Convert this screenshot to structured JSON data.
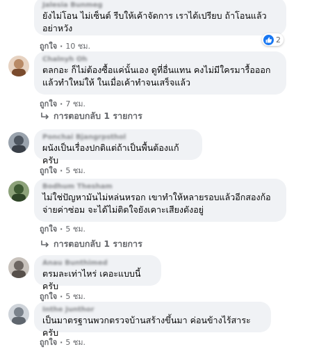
{
  "comments": [
    {
      "author": "Jalesia Bunmeg",
      "text": "ยังไม่โอน ไม่เซ็นต์ รีบให้เค้าจัดการ เราได้เปรียบ ถ้าโอนแล้ว\nอย่าหวัง",
      "like_label": "ถูกใจ",
      "time": "10 ชม.",
      "reaction_count": "2",
      "avatar_color": "#c9cdd3"
    },
    {
      "author": "Chalnyh Oh",
      "text": "ตลกอะ ก็ไม่ต้องซื้อแค่นั้นเอง ดูที่อื่นแทน คงไม่มีใครมารื้อออก\nแล้วทำใหม่ให้ ในเมื่อเค้าทำจนเสร็จแล้ว",
      "like_label": "ถูกใจ",
      "time": "7 ชม.",
      "replies": "การตอบกลับ 1 รายการ",
      "avatar_color": "#b88a66"
    },
    {
      "author": "Ponchai Bjangrpsthol",
      "text": "ผนังเป็นเรื่องปกติแต่ถ้าเป็นพื้นต้องแก้ครับ",
      "like_label": "ถูกใจ",
      "time": "5 ชม.",
      "avatar_color": "#6c7580"
    },
    {
      "author": "Bodhum Thesham",
      "text": "ไม่ใช่ปัญหามันไม่หล่นหรอก เขาทำให้หลายรอบแล้วอีกสองก้อ\nจ่ายค่าซ่อม จะได้ไม่ติดใจยังเคาะเสียงดังอยู่",
      "like_label": "ถูกใจ",
      "time": "5 ชม.",
      "replies": "การตอบกลับ 1 รายการ",
      "avatar_color": "#5d7d4e"
    },
    {
      "author": "Anau Bunthimed",
      "text": "ตรมละเท่าไหร่ เคอะแบบนี้ครับ",
      "like_label": "ถูกใจ",
      "time": "5 ชม.",
      "avatar_color": "#8f8a86"
    },
    {
      "author": "Inthe Junthor",
      "text": "เป็นมาตรฐานพวกตรวจบ้านสร้างขึ้นมา ค่อนข้างไร้สาระ ครับ",
      "like_label": "ถูกใจ",
      "time": "5 ชม.",
      "avatar_color": "#9aa1aa"
    }
  ],
  "colors": {
    "bubble": "#f0f2f5",
    "meta_text": "#65676b",
    "like_blue": "#1877f2"
  }
}
